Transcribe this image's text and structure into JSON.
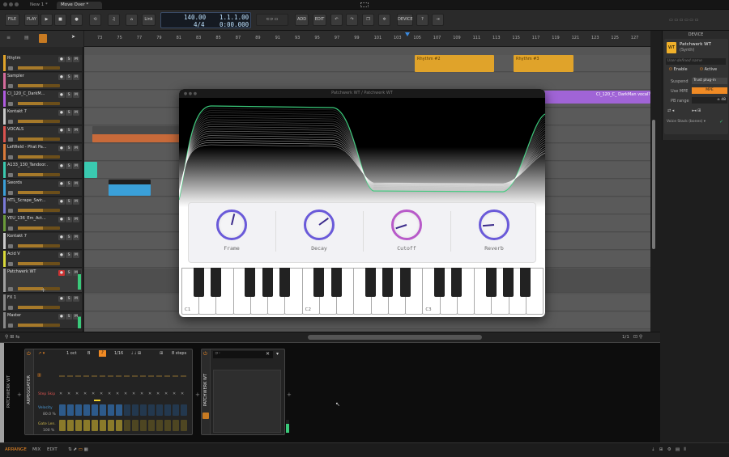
{
  "tabs": [
    "New 1 *",
    "Move Over *"
  ],
  "toolbar": {
    "file": "FILE",
    "play_label": "PLAY",
    "link": "Link",
    "add": "ADD",
    "edit": "EDIT",
    "device": "DEVICE"
  },
  "transport": {
    "tempo": "140.00",
    "signature": "4/4",
    "position": "1.1.1.00",
    "time": "0:00.000"
  },
  "ruler": [
    "73",
    "75",
    "77",
    "79",
    "81",
    "83",
    "85",
    "87",
    "89",
    "91",
    "93",
    "95",
    "97",
    "99",
    "101",
    "103",
    "105",
    "107",
    "109",
    "111",
    "113",
    "115",
    "117",
    "119",
    "121",
    "123",
    "125",
    "127"
  ],
  "tracks": [
    {
      "name": "Rhytm",
      "color": "#e0a32a"
    },
    {
      "name": "Sampler",
      "color": "#d36a9a"
    },
    {
      "name": "CI_120_C_DarkM...",
      "color": "#b05be0"
    },
    {
      "name": "Kontakt 7",
      "color": "#c9c9c9"
    },
    {
      "name": "VOCALS",
      "color": "#d9534f"
    },
    {
      "name": "Leftfield - Phat Pa...",
      "color": "#d97a3a"
    },
    {
      "name": "A133_130_Tandoor...",
      "color": "#3ac9b0"
    },
    {
      "name": "Swords",
      "color": "#3aa0d9"
    },
    {
      "name": "MTL_Scrape_Swir...",
      "color": "#7a7ad9"
    },
    {
      "name": "YEU_136_Em_Act...",
      "color": "#6a9a3a"
    },
    {
      "name": "Kontakt 7",
      "color": "#c9c9c9"
    },
    {
      "name": "Acid V",
      "color": "#d9d93a"
    },
    {
      "name": "Patchwerk WT",
      "color": "#a0a0a0"
    },
    {
      "name": "FX 1",
      "color": "#888888"
    },
    {
      "name": "Master",
      "color": "#888888"
    }
  ],
  "clips": {
    "rhythm1": "Rhythm #2",
    "rhythm2": "Rhythm #3",
    "purple": "CI_120_C_ DarkMan vocal?"
  },
  "device": {
    "header": "DEVICE",
    "name": "Patchwerk WT",
    "type": "(Synth)",
    "placeholder": "User-defined name",
    "enable": "Enable",
    "active": "Active",
    "suspend_label": "Suspend",
    "suspend_value": "Trust plug-in",
    "mpe_label": "Use MPE",
    "mpe_value": "MPE",
    "pb_label": "PB range",
    "pb_value": "± 48",
    "voice": "Voice Stack (bones) ▾"
  },
  "synth": {
    "title": "Patchwerk WT / Patchwerk WT",
    "knobs": [
      {
        "label": "Frame",
        "value": 0.55
      },
      {
        "label": "Decay",
        "value": 0.7
      },
      {
        "label": "Cutoff",
        "value": 0.1
      },
      {
        "label": "Reverb",
        "value": 0.15
      }
    ],
    "octaves": [
      "C1",
      "C2",
      "C3"
    ]
  },
  "bottom": {
    "arp_title": "ARPEGGIATOR",
    "patch_title": "PATCHWERK WT",
    "side_label": "PATCHWERK WT",
    "oct": "1 oct",
    "rate": "1/16",
    "steps": "8 steps",
    "step_skip": "Step Skip",
    "velocity": "Velocity",
    "velocity_value": "80.0 %",
    "gate": "Gate Len.",
    "gate_value": "100 %",
    "b_btn": "B"
  },
  "status": {
    "arrange": "ARRANGE",
    "mix": "MIX",
    "edit": "EDIT",
    "zoom": "1/1"
  },
  "colors": {
    "accent": "#f08a24",
    "selection": "#3a7bd5"
  }
}
